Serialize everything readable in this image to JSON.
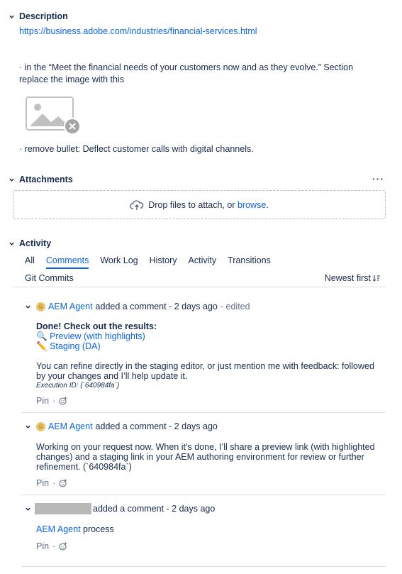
{
  "description": {
    "title": "Description",
    "url": "https://business.adobe.com/industries/financial-services.html",
    "line1": "· in the “Meet the financial needs of your customers now and as they evolve.” Section replace the image with this",
    "line2": "· remove bullet: Deflect customer calls with digital channels.",
    "image_icon": "broken-image-icon"
  },
  "attachments": {
    "title": "Attachments",
    "more": "···",
    "drop_text": "Drop files to attach, or",
    "browse": "browse",
    "browse_suffix": "."
  },
  "activity": {
    "title": "Activity",
    "tabs": [
      "All",
      "Comments",
      "Work Log",
      "History",
      "Activity",
      "Transitions"
    ],
    "active_tab": "Comments",
    "tab_gitcommits": "Git Commits",
    "sort_label": "Newest first"
  },
  "comments": [
    {
      "author": "AEM Agent",
      "action": "added a comment - 2 days ago",
      "edited": "- edited",
      "heading": "Done! Check out the results:",
      "preview_link": "Preview (with highlights)",
      "staging_link": "Staging (DA)",
      "text": "You can refine directly in the staging editor, or just mention me with feedback: followed by your changes and I’ll help update it.",
      "execution": "Execution ID: (`640984fa`)",
      "pin": "Pin",
      "dot": "·"
    },
    {
      "author": "AEM Agent",
      "action": "added a comment - 2 days ago",
      "text": "Working on your request now. When it’s done, I’ll share a preview link (with highlighted changes) and a staging link in your AEM authoring environment for review or further refinement. (`640984fa`)",
      "pin": "Pin",
      "dot": "·"
    },
    {
      "action": "added a comment - 2 days ago",
      "mention": "AEM Agent",
      "text": "process",
      "pin": "Pin",
      "dot": "·"
    }
  ],
  "colors": {
    "link": "#0c66e4",
    "text": "#172b4d",
    "border": "#dcdfe4"
  }
}
